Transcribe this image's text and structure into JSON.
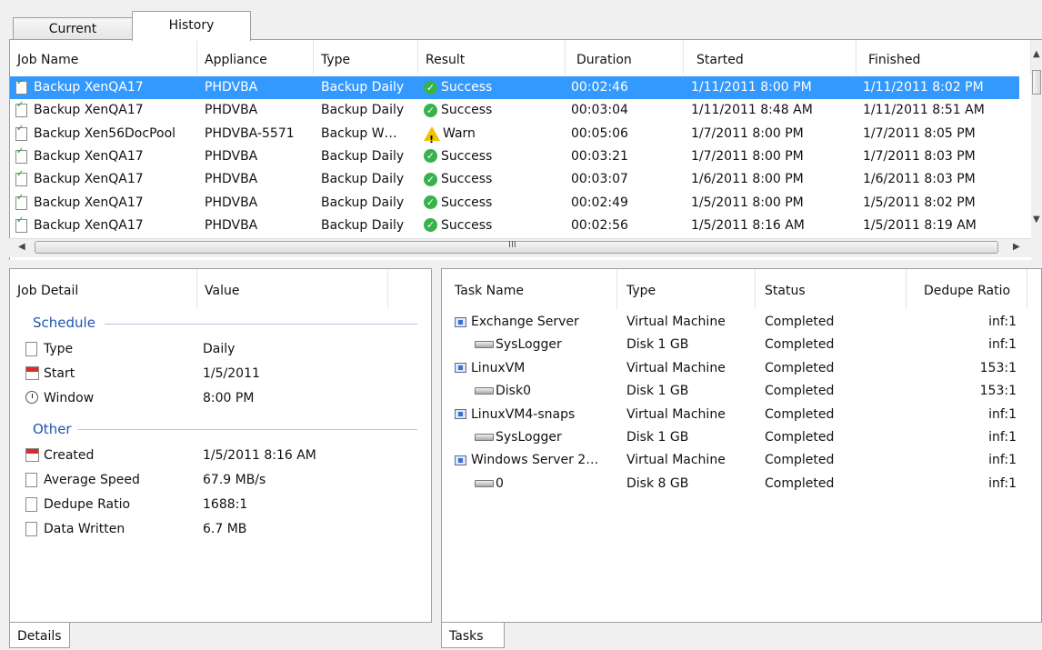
{
  "tabs": {
    "current": "Current",
    "history": "History"
  },
  "history_table": {
    "columns": [
      "Job Name",
      "Appliance",
      "Type",
      "Result",
      "Duration",
      "Started",
      "Finished"
    ],
    "rows": [
      {
        "job": "Backup XenQA17",
        "appliance": "PHDVBA",
        "type": "Backup Daily",
        "result": "Success",
        "duration": "00:02:46",
        "started": "1/11/2011 8:00 PM",
        "finished": "1/11/2011 8:02 PM"
      },
      {
        "job": "Backup XenQA17",
        "appliance": "PHDVBA",
        "type": "Backup Daily",
        "result": "Success",
        "duration": "00:03:04",
        "started": "1/11/2011 8:48 AM",
        "finished": "1/11/2011 8:51 AM"
      },
      {
        "job": "Backup Xen56DocPool",
        "appliance": "PHDVBA-5571",
        "type": "Backup W…",
        "result": "Warn",
        "duration": "00:05:06",
        "started": "1/7/2011 8:00 PM",
        "finished": "1/7/2011 8:05 PM"
      },
      {
        "job": "Backup XenQA17",
        "appliance": "PHDVBA",
        "type": "Backup Daily",
        "result": "Success",
        "duration": "00:03:21",
        "started": "1/7/2011 8:00 PM",
        "finished": "1/7/2011 8:03 PM"
      },
      {
        "job": "Backup XenQA17",
        "appliance": "PHDVBA",
        "type": "Backup Daily",
        "result": "Success",
        "duration": "00:03:07",
        "started": "1/6/2011 8:00 PM",
        "finished": "1/6/2011 8:03 PM"
      },
      {
        "job": "Backup XenQA17",
        "appliance": "PHDVBA",
        "type": "Backup Daily",
        "result": "Success",
        "duration": "00:02:49",
        "started": "1/5/2011 8:00 PM",
        "finished": "1/5/2011 8:02 PM"
      },
      {
        "job": "Backup XenQA17",
        "appliance": "PHDVBA",
        "type": "Backup Daily",
        "result": "Success",
        "duration": "00:02:56",
        "started": "1/5/2011 8:16 AM",
        "finished": "1/5/2011 8:19 AM"
      }
    ],
    "selected_row": 0,
    "scroll_grip": "III"
  },
  "job_detail": {
    "columns": [
      "Job Detail",
      "Value"
    ],
    "schedule_label": "Schedule",
    "schedule": [
      {
        "label": "Type",
        "value": "Daily",
        "icon": "document-icon"
      },
      {
        "label": "Start",
        "value": "1/5/2011",
        "icon": "calendar-icon"
      },
      {
        "label": "Window",
        "value": "8:00 PM",
        "icon": "clock-icon"
      }
    ],
    "other_label": "Other",
    "other": [
      {
        "label": "Created",
        "value": "1/5/2011 8:16 AM",
        "icon": "calendar-icon"
      },
      {
        "label": "Average Speed",
        "value": "67.9 MB/s",
        "icon": "document-icon"
      },
      {
        "label": "Dedupe Ratio",
        "value": "1688:1",
        "icon": "document-icon"
      },
      {
        "label": "Data Written",
        "value": "6.7 MB",
        "icon": "document-icon"
      }
    ],
    "tab": "Details"
  },
  "tasks": {
    "columns": [
      "Task Name",
      "Type",
      "Status",
      "Dedupe Ratio"
    ],
    "rows": [
      {
        "name": "Exchange Server",
        "type": "Virtual Machine",
        "status": "Completed",
        "ratio": "inf:1",
        "kind": "vm"
      },
      {
        "name": "SysLogger",
        "type": "Disk 1 GB",
        "status": "Completed",
        "ratio": "inf:1",
        "kind": "disk"
      },
      {
        "name": "LinuxVM",
        "type": "Virtual Machine",
        "status": "Completed",
        "ratio": "153:1",
        "kind": "vm"
      },
      {
        "name": "Disk0",
        "type": "Disk 1 GB",
        "status": "Completed",
        "ratio": "153:1",
        "kind": "disk"
      },
      {
        "name": "LinuxVM4-snaps",
        "type": "Virtual Machine",
        "status": "Completed",
        "ratio": "inf:1",
        "kind": "vm"
      },
      {
        "name": "SysLogger",
        "type": "Disk 1 GB",
        "status": "Completed",
        "ratio": "inf:1",
        "kind": "disk"
      },
      {
        "name": "Windows Server 2…",
        "type": "Virtual Machine",
        "status": "Completed",
        "ratio": "inf:1",
        "kind": "vm"
      },
      {
        "name": "0",
        "type": "Disk 8 GB",
        "status": "Completed",
        "ratio": "inf:1",
        "kind": "disk"
      }
    ],
    "tab": "Tasks"
  },
  "colors": {
    "selection": "#3399ff",
    "section": "#1f55b5",
    "success": "#38b24a",
    "warn": "#f2c200"
  }
}
